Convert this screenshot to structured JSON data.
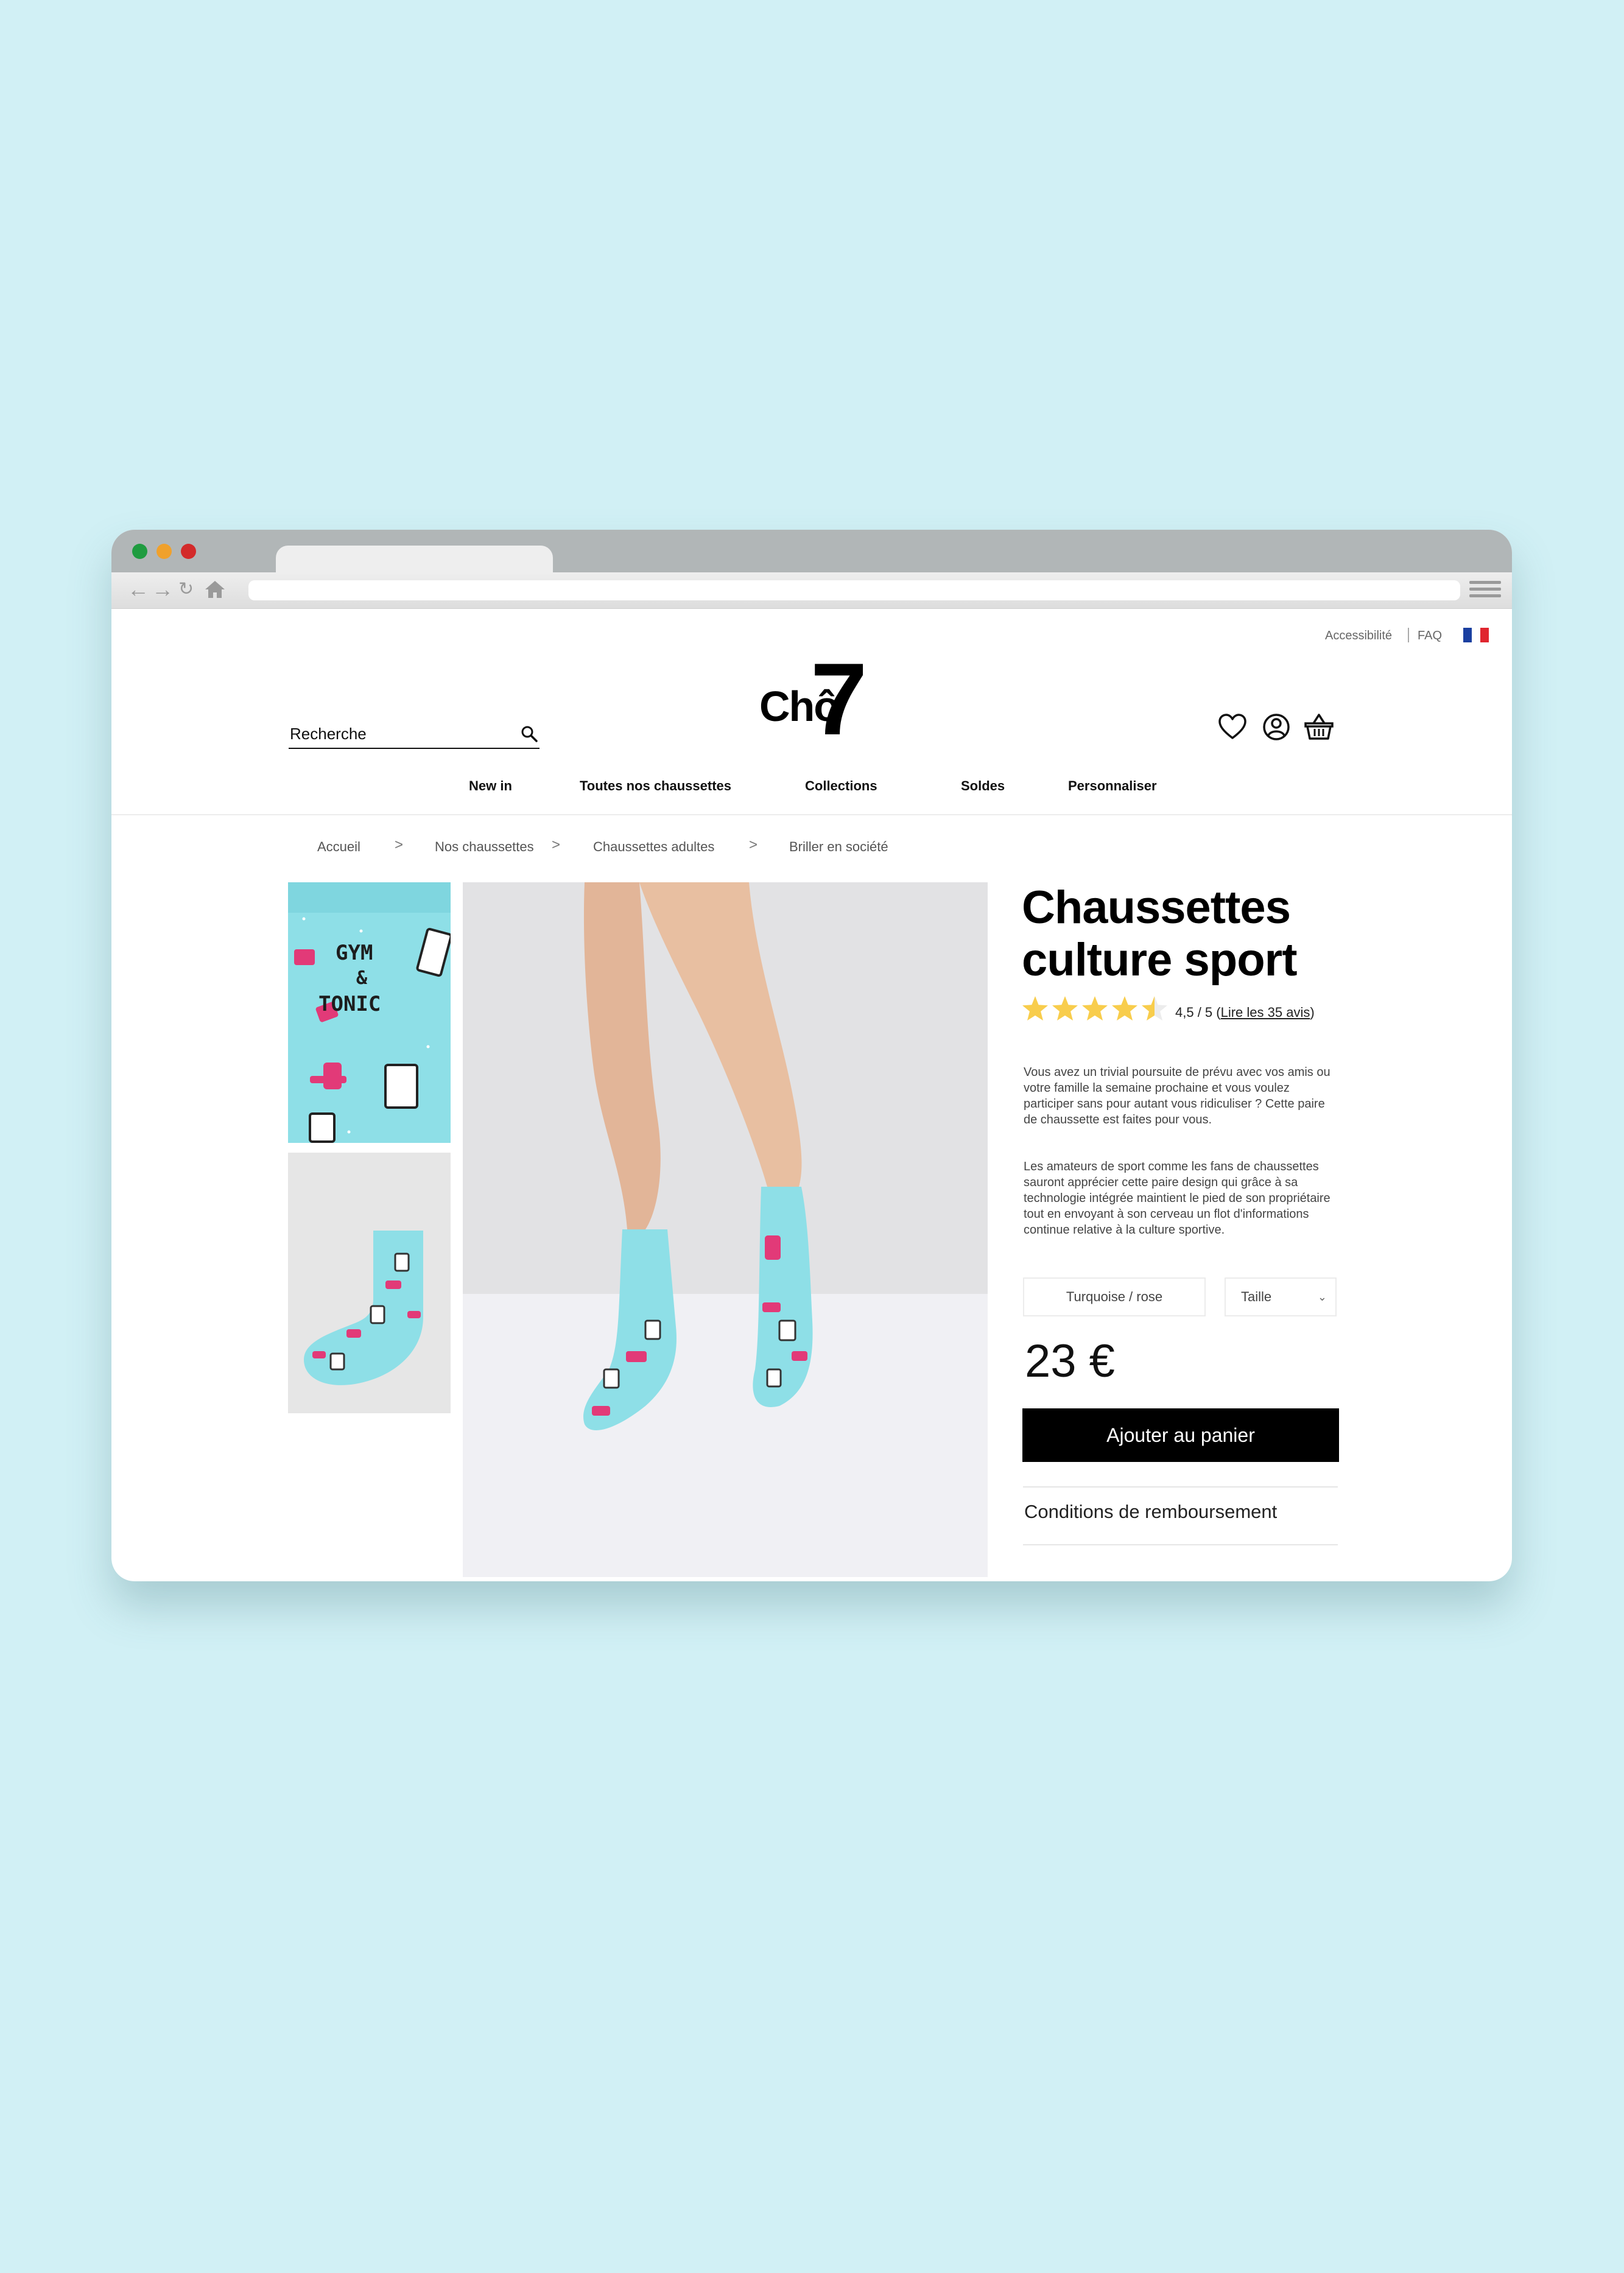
{
  "browser": {
    "traffic_lights": [
      "#1f9c40",
      "#f0a12c",
      "#d32a2a"
    ],
    "nav_icons": [
      "back-arrow-icon",
      "forward-arrow-icon",
      "reload-icon",
      "home-icon"
    ],
    "menu_icon": "hamburger-menu-icon"
  },
  "utility": {
    "accessibility": "Accessibilité",
    "faq": "FAQ",
    "language_flag": "french-flag-icon",
    "flag_colors": [
      "#1a3fa0",
      "#ffffff",
      "#e0262f"
    ]
  },
  "header": {
    "logo": {
      "brand": "Chô",
      "mark": "7"
    },
    "search": {
      "placeholder": "Recherche",
      "icon": "search-icon"
    },
    "icons": [
      "heart-icon",
      "user-icon",
      "basket-icon"
    ]
  },
  "nav": [
    "New in",
    "Toutes nos chaussettes",
    "Collections",
    "Soldes",
    "Personnaliser"
  ],
  "breadcrumb": [
    "Accueil",
    "Nos chaussettes",
    "Chaussettes adultes",
    "Briller en société"
  ],
  "breadcrumb_separator": ">",
  "gallery": {
    "thumb_text": [
      "GYM",
      "&",
      "TONIC"
    ],
    "sock_color": "#8edfe7",
    "accent_color": "#e23a78"
  },
  "product": {
    "title_line1": "Chaussettes",
    "title_line2": "culture sport",
    "rating_value": 4.5,
    "rating_max": 5,
    "rating_text": "4,5 / 5 (",
    "reviews_link": "Lire les 35 avis",
    "rating_close": ")",
    "star_color": "#f8cd4c",
    "description_1": "Vous avez un trivial poursuite de prévu avec vos amis ou votre famille la semaine prochaine et vous voulez participer sans pour autant vous ridiculiser ? Cette paire de chaussette est faites pour vous.",
    "description_2": "Les amateurs de sport comme les fans de chaussettes sauront apprécier cette paire design qui grâce à sa technologie intégrée maintient le pied de son propriétaire tout en envoyant à son cerveau un flot d'informations continue relative à la culture sportive.",
    "color_option": "Turquoise / rose",
    "size_placeholder": "Taille",
    "price": "23 €",
    "add_to_cart": "Ajouter au panier",
    "refund_conditions": "Conditions de remboursement"
  }
}
